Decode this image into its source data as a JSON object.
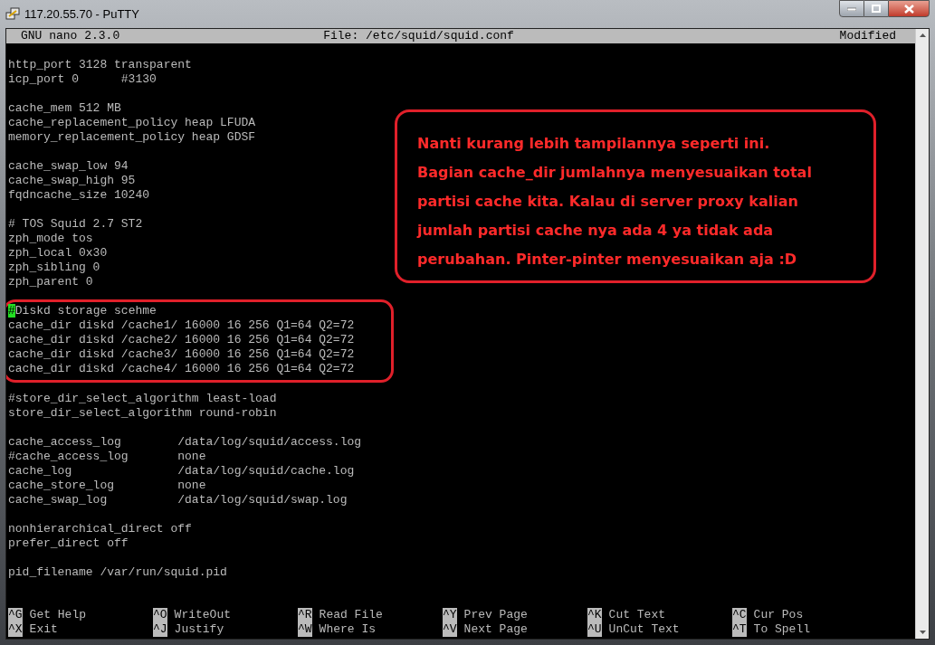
{
  "window": {
    "title": "117.20.55.70 - PuTTY"
  },
  "editor": {
    "app": "GNU nano 2.3.0",
    "file": "File: /etc/squid/squid.conf",
    "status": "Modified"
  },
  "blocks": [
    {
      "lines": [
        "http_port 3128 transparent",
        "icp_port 0      #3130"
      ],
      "annotated": false,
      "cursor_on_first_char": false
    },
    {
      "lines": [
        "cache_mem 512 MB",
        "cache_replacement_policy heap LFUDA",
        "memory_replacement_policy heap GDSF"
      ],
      "annotated": false,
      "cursor_on_first_char": false
    },
    {
      "lines": [
        "cache_swap_low 94",
        "cache_swap_high 95",
        "fqdncache_size 10240"
      ],
      "annotated": false,
      "cursor_on_first_char": false
    },
    {
      "lines": [
        "# TOS Squid 2.7 ST2",
        "zph_mode tos",
        "zph_local 0x30",
        "zph_sibling 0",
        "zph_parent 0"
      ],
      "annotated": false,
      "cursor_on_first_char": false
    },
    {
      "lines": [
        "#Diskd storage scehme",
        "cache_dir diskd /cache1/ 16000 16 256 Q1=64 Q2=72",
        "cache_dir diskd /cache2/ 16000 16 256 Q1=64 Q2=72",
        "cache_dir diskd /cache3/ 16000 16 256 Q1=64 Q2=72",
        "cache_dir diskd /cache4/ 16000 16 256 Q1=64 Q2=72"
      ],
      "annotated": true,
      "cursor_on_first_char": true
    },
    {
      "lines": [
        "#store_dir_select_algorithm least-load",
        "store_dir_select_algorithm round-robin"
      ],
      "annotated": false,
      "cursor_on_first_char": false
    },
    {
      "lines": [
        "cache_access_log        /data/log/squid/access.log",
        "#cache_access_log       none",
        "cache_log               /data/log/squid/cache.log",
        "cache_store_log         none",
        "cache_swap_log          /data/log/squid/swap.log"
      ],
      "annotated": false,
      "cursor_on_first_char": false
    },
    {
      "lines": [
        "nonhierarchical_direct off",
        "prefer_direct off"
      ],
      "annotated": false,
      "cursor_on_first_char": false
    },
    {
      "lines": [
        "pid_filename /var/run/squid.pid"
      ],
      "annotated": false,
      "cursor_on_first_char": false
    }
  ],
  "note": {
    "lines": [
      "Nanti kurang lebih tampilannya seperti ini.",
      "Bagian cache_dir jumlahnya menyesuaikan total",
      "partisi cache kita. Kalau di server proxy kalian",
      "jumlah partisi cache nya ada 4 ya tidak ada",
      "perubahan. Pinter-pinter menyesuaikan aja :D"
    ]
  },
  "shortcuts": [
    [
      {
        "key": "^G",
        "label": "Get Help"
      },
      {
        "key": "^O",
        "label": "WriteOut"
      },
      {
        "key": "^R",
        "label": "Read File"
      },
      {
        "key": "^Y",
        "label": "Prev Page"
      },
      {
        "key": "^K",
        "label": "Cut Text"
      },
      {
        "key": "^C",
        "label": "Cur Pos"
      }
    ],
    [
      {
        "key": "^X",
        "label": "Exit"
      },
      {
        "key": "^J",
        "label": "Justify"
      },
      {
        "key": "^W",
        "label": "Where Is"
      },
      {
        "key": "^V",
        "label": "Next Page"
      },
      {
        "key": "^U",
        "label": "UnCut Text"
      },
      {
        "key": "^T",
        "label": "To Spell"
      }
    ]
  ]
}
